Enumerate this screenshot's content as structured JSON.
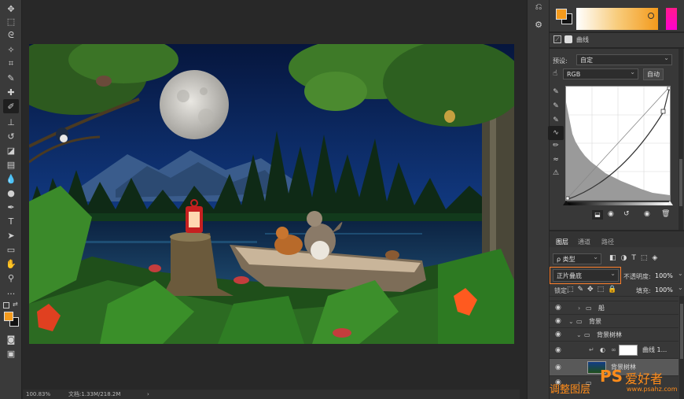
{
  "status": {
    "zoom": "100.83%",
    "doc_info": "文档:1.33M/218.2M",
    "arrow": "›"
  },
  "properties": {
    "adjust_label": "曲线",
    "preset_label": "预设:",
    "preset_value": "自定",
    "channel_value": "RGB",
    "auto_label": "自动"
  },
  "layers_panel": {
    "tabs": [
      "图层",
      "通道",
      "路径"
    ],
    "filter_kind": "ρ 类型",
    "blend_mode": "正片叠底",
    "opacity_label": "不透明度:",
    "opacity_value": "100%",
    "lock_label": "锁定:",
    "fill_label": "填充:",
    "fill_value": "100%",
    "layers": [
      {
        "name": "船",
        "type": "group",
        "indent": 1
      },
      {
        "name": "背景",
        "type": "group",
        "indent": 0
      },
      {
        "name": "背景树林",
        "type": "group",
        "indent": 1
      },
      {
        "name": "曲线 1...",
        "type": "adjustment",
        "indent": 2
      },
      {
        "name": "背景树林",
        "type": "pixel",
        "indent": 2
      }
    ]
  },
  "watermark": {
    "ps": "PS",
    "site_cn": "爱好者",
    "url": "www.psahz.com",
    "caption": "调整图层"
  },
  "colors": {
    "foreground": "#f39a1c",
    "background": "#111111",
    "highlight_box": "#ff7f2a"
  }
}
